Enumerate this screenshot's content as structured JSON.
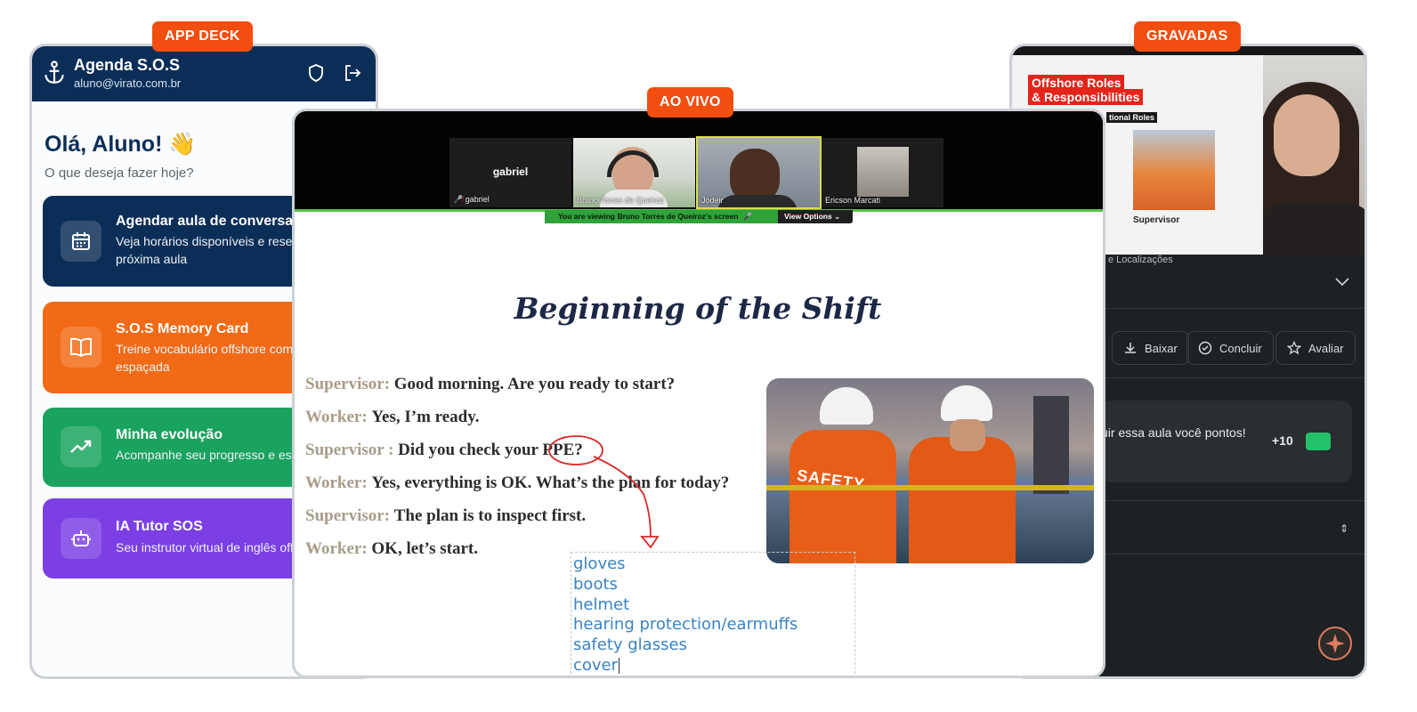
{
  "tags": {
    "app_deck": "APP DECK",
    "ao_vivo": "AO VIVO",
    "gravadas": "GRAVADAS"
  },
  "app_deck": {
    "title": "Agenda S.O.S",
    "email": "aluno@virato.com.br",
    "greeting": "Olá, Aluno! 👋",
    "subtitle": "O que deseja fazer hoje?",
    "cards": [
      {
        "title": "Agendar aula de conversaçã",
        "desc": "Veja horários disponíveis e reserv próxima aula",
        "icon": "calendar-icon",
        "color": "#0b2e57"
      },
      {
        "title": "S.O.S Memory Card",
        "desc": "Treine vocabulário offshore com espaçada",
        "icon": "book-icon",
        "color": "#f26a16"
      },
      {
        "title": "Minha evolução",
        "desc": "Acompanhe seu progresso e esta",
        "icon": "trending-up-icon",
        "color": "#1aa35e"
      },
      {
        "title": "IA Tutor SOS",
        "desc": "Seu instrutor virtual de inglês off",
        "icon": "robot-icon",
        "color": "#7b3fe4"
      }
    ]
  },
  "ao_vivo": {
    "participants": [
      {
        "name": "gabriel",
        "label": "gabriel"
      },
      {
        "name": "Bruno Torres de Queiroz"
      },
      {
        "name": "Jodeir"
      },
      {
        "name": "Ericson Marcati"
      }
    ],
    "viewing_banner": "You are viewing  Bruno Torres de Queiroz's screen",
    "view_options": "View Options",
    "slide_title": "Beginning of the Shift",
    "dialogue": [
      {
        "speaker": "Supervisor:",
        "text": "Good morning. Are you ready to start?"
      },
      {
        "speaker": "Worker:",
        "text": "Yes, I’m ready."
      },
      {
        "speaker": "Supervisor :",
        "text": "Did you check your PPE?"
      },
      {
        "speaker": "Worker:",
        "text": "Yes, everything is OK. What’s the plan for today?"
      },
      {
        "speaker": "Supervisor:",
        "text": "The plan is to inspect first."
      },
      {
        "speaker": "Worker:",
        "text": "OK, let’s start."
      }
    ],
    "photo_text": "SAFETY",
    "notes": [
      "gloves",
      "boots",
      "helmet",
      "hearing protection/earmuffs",
      "safety glasses",
      "cover"
    ]
  },
  "gravadas": {
    "slide_title_1": "Offshore Roles",
    "slide_title_2": "& Responsibilities",
    "slide_tag": "tional Roles",
    "slide_caption": "Supervisor",
    "location": "e Localizações",
    "buttons": [
      "Baixar",
      "Concluir",
      "Avaliar"
    ],
    "points_text": "uir essa aula você pontos!",
    "points_value": "+10"
  }
}
